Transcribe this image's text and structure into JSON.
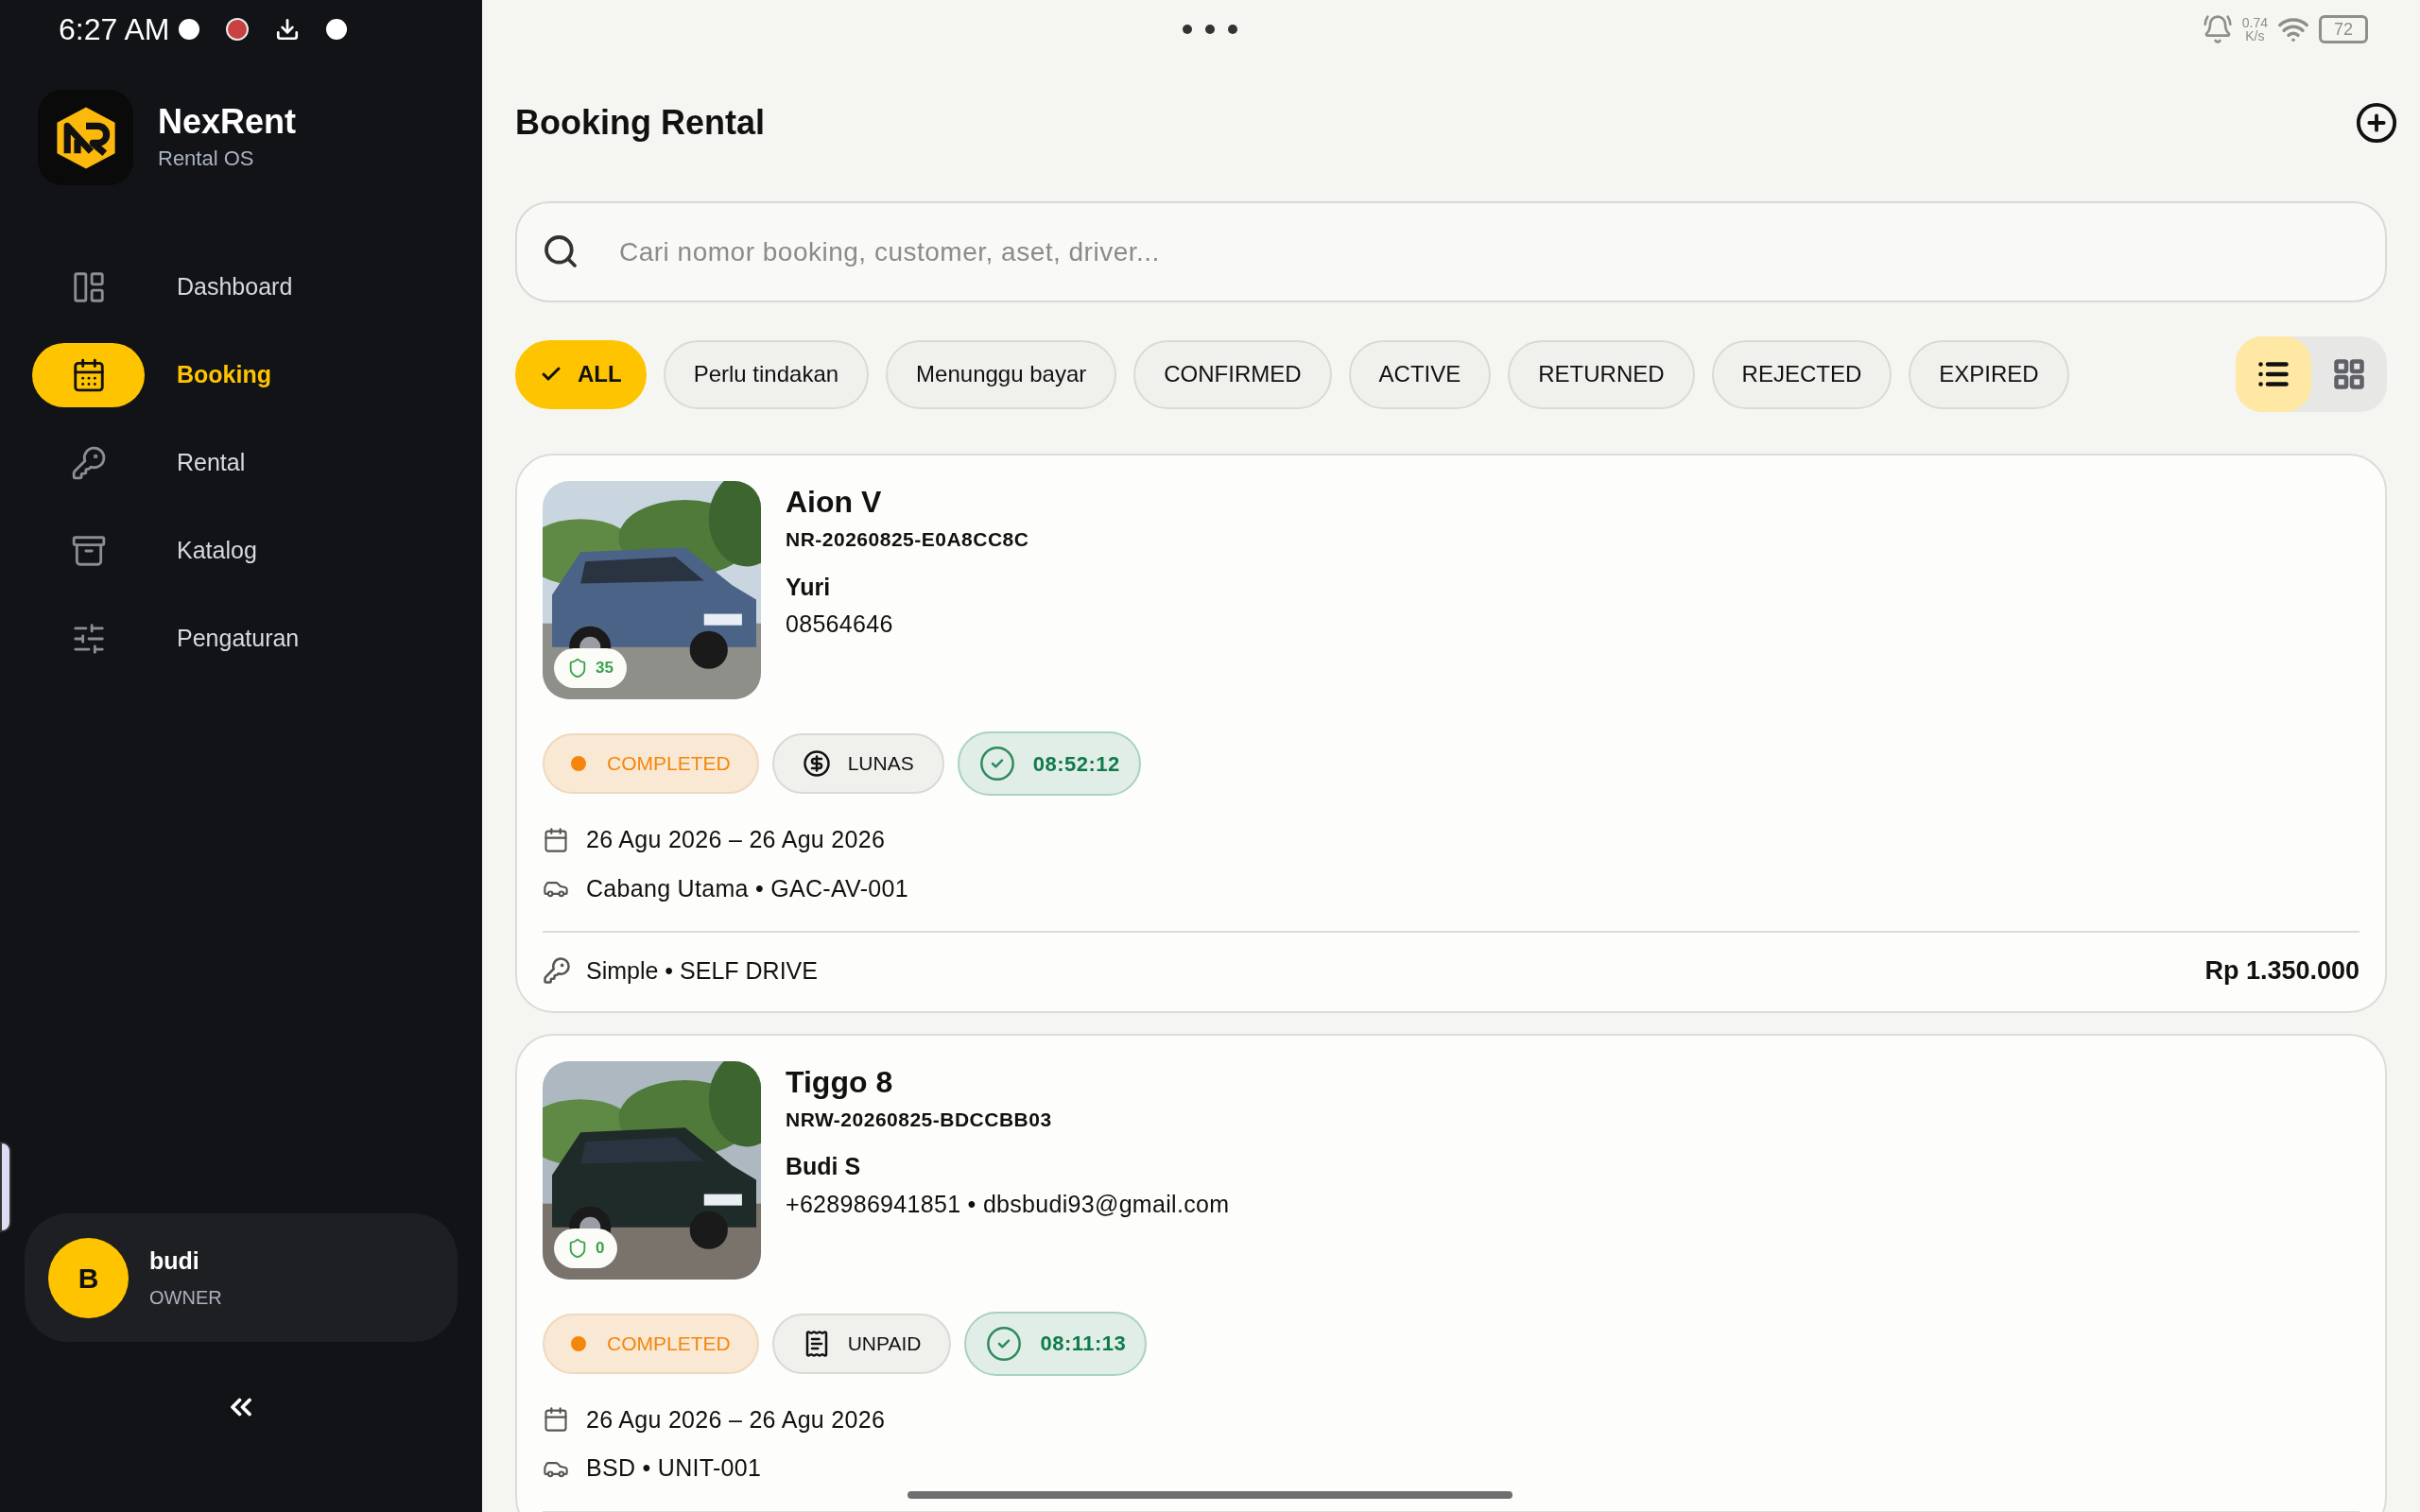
{
  "status_bar": {
    "time": "6:27 AM",
    "speed_value": "0.74",
    "speed_unit": "K/s",
    "battery": "72"
  },
  "sidebar": {
    "brand": {
      "name": "NexRent",
      "subtitle": "Rental OS"
    },
    "items": [
      {
        "label": "Dashboard",
        "kind": "dashboard",
        "selected": false
      },
      {
        "label": "Booking",
        "kind": "booking",
        "selected": true
      },
      {
        "label": "Rental",
        "kind": "rental",
        "selected": false
      },
      {
        "label": "Katalog",
        "kind": "catalog",
        "selected": false
      },
      {
        "label": "Pengaturan",
        "kind": "settings",
        "selected": false
      }
    ],
    "user": {
      "initial": "B",
      "name": "budi",
      "role": "OWNER"
    }
  },
  "header": {
    "title": "Booking Rental"
  },
  "search": {
    "placeholder": "Cari nomor booking, customer, aset, driver..."
  },
  "filters": [
    {
      "label": "ALL",
      "selected": true
    },
    {
      "label": "Perlu tindakan",
      "selected": false
    },
    {
      "label": "Menunggu bayar",
      "selected": false
    },
    {
      "label": "CONFIRMED",
      "selected": false
    },
    {
      "label": "ACTIVE",
      "selected": false
    },
    {
      "label": "RETURNED",
      "selected": false
    },
    {
      "label": "REJECTED",
      "selected": false
    },
    {
      "label": "EXPIRED",
      "selected": false
    }
  ],
  "view_toggle": [
    {
      "kind": "list",
      "selected": true
    },
    {
      "kind": "grid",
      "selected": false
    }
  ],
  "bookings": [
    {
      "vehicle": "Aion V",
      "code": "NR-20260825-E0A8CC8C",
      "customer": "Yuri",
      "contact": "08564646",
      "safety_score": "35",
      "status": "COMPLETED",
      "payment": {
        "kind": "paid",
        "label": "LUNAS"
      },
      "timer": "08:52:12",
      "dates": "26 Agu 2026 – 26 Agu 2026",
      "location": "Cabang Utama • GAC-AV-001",
      "package": "Simple • SELF DRIVE",
      "price": "Rp 1.350.000"
    },
    {
      "vehicle": "Tiggo 8",
      "code": "NRW-20260825-BDCCBB03",
      "customer": "Budi S",
      "contact": "+628986941851 • dbsbudi93@gmail.com",
      "safety_score": "0",
      "status": "COMPLETED",
      "payment": {
        "kind": "unpaid",
        "label": "UNPAID"
      },
      "timer": "08:11:13",
      "dates": "26 Agu 2026 – 26 Agu 2026",
      "location": "BSD • UNIT-001"
    }
  ]
}
